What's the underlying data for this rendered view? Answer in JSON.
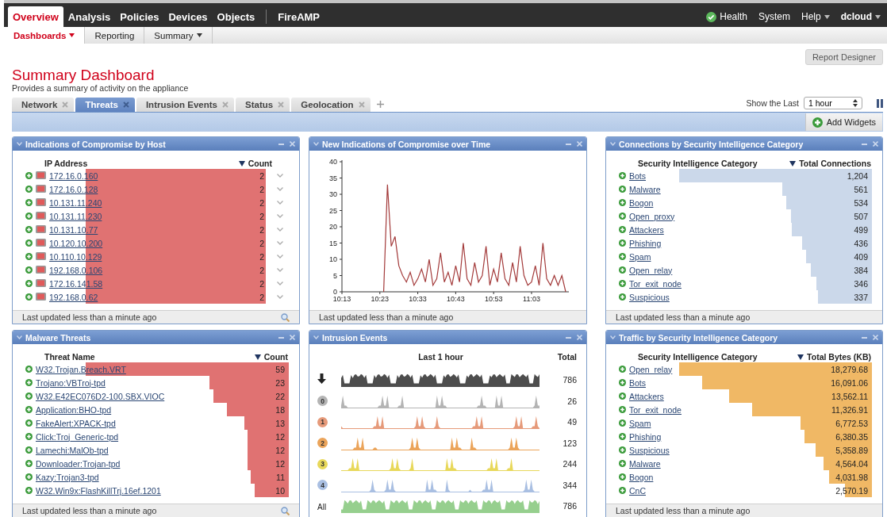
{
  "nav": {
    "items": [
      {
        "label": "Overview",
        "selected": true,
        "divider_before": false
      },
      {
        "label": "Analysis",
        "selected": false,
        "divider_before": false
      },
      {
        "label": "Policies",
        "selected": false,
        "divider_before": false
      },
      {
        "label": "Devices",
        "selected": false,
        "divider_before": false
      },
      {
        "label": "Objects",
        "selected": false,
        "divider_before": false
      },
      {
        "label": "FireAMP",
        "selected": false,
        "divider_before": true
      }
    ],
    "right": [
      {
        "label": "Health",
        "kind": "health"
      },
      {
        "label": "System",
        "kind": "link"
      },
      {
        "label": "Help",
        "kind": "menu"
      },
      {
        "label": "dcloud",
        "kind": "user"
      }
    ]
  },
  "subnav": [
    {
      "label": "Dashboards",
      "selected": true,
      "menu": true
    },
    {
      "label": "Reporting",
      "selected": false,
      "menu": false
    },
    {
      "label": "Summary",
      "selected": false,
      "menu": true
    }
  ],
  "report_button": "Report Designer",
  "title": "Summary Dashboard",
  "subtitle": "Provides a summary of activity on the appliance",
  "tabs": [
    {
      "label": "Network",
      "selected": false
    },
    {
      "label": "Threats",
      "selected": true
    },
    {
      "label": "Intrusion Events",
      "selected": false
    },
    {
      "label": "Status",
      "selected": false
    },
    {
      "label": "Geolocation",
      "selected": false
    }
  ],
  "show_last": {
    "label": "Show the Last",
    "value": "1 hour"
  },
  "add_widgets": "Add Widgets",
  "widgets": [
    {
      "kind": "bar_table",
      "title": "Indications of Compromise by Host",
      "color": "#e07272",
      "host_icons": true,
      "row_menu": true,
      "columns": [
        "IP Address",
        "Count"
      ],
      "rows": [
        {
          "label": "172.16.0.160",
          "value": "2"
        },
        {
          "label": "172.16.0.128",
          "value": "2"
        },
        {
          "label": "10.131.11.240",
          "value": "2"
        },
        {
          "label": "10.131.11.230",
          "value": "2"
        },
        {
          "label": "10.131.10.77",
          "value": "2"
        },
        {
          "label": "10.120.10.200",
          "value": "2"
        },
        {
          "label": "10.110.10.129",
          "value": "2"
        },
        {
          "label": "192.168.0.106",
          "value": "2"
        },
        {
          "label": "172.16.141.58",
          "value": "2"
        },
        {
          "label": "192.168.0.62",
          "value": "2"
        }
      ],
      "footer": {
        "text": "Last updated less than a minute ago",
        "search": true
      }
    },
    {
      "kind": "line_chart",
      "title": "New Indications of Compromise over Time",
      "chart_data": {
        "type": "line",
        "categories": [
          "10:13",
          null,
          null,
          null,
          null,
          null,
          null,
          null,
          null,
          null,
          "10:23",
          null,
          null,
          null,
          null,
          null,
          null,
          null,
          null,
          null,
          "10:33",
          null,
          null,
          null,
          null,
          null,
          null,
          null,
          null,
          null,
          "10:43",
          null,
          null,
          null,
          null,
          null,
          null,
          null,
          null,
          null,
          "10:53",
          null,
          null,
          null,
          null,
          null,
          null,
          null,
          null,
          null,
          "11:03",
          null,
          null,
          null,
          null,
          null,
          null,
          null,
          null,
          null
        ],
        "series": [
          {
            "color": "#a33a3a",
            "values": [
              null,
              null,
              null,
              null,
              null,
              null,
              null,
              null,
              null,
              null,
              null,
              0,
              33,
              14,
              17,
              8,
              5,
              3,
              6,
              2,
              4,
              7,
              3,
              10,
              2,
              4,
              12,
              3,
              6,
              2,
              8,
              3,
              15,
              4,
              2,
              9,
              3,
              5,
              14,
              2,
              7,
              3,
              12,
              4,
              2,
              9,
              3,
              14,
              5,
              2,
              3,
              8,
              2,
              15,
              4,
              2,
              5,
              2,
              5,
              0
            ]
          }
        ],
        "ylim": [
          0,
          40
        ],
        "yticks": [
          0,
          5,
          10,
          15,
          20,
          25,
          30,
          35,
          40
        ]
      },
      "footer": {
        "text": "Last updated less than a minute ago",
        "search": false
      }
    },
    {
      "kind": "bar_table",
      "title": "Connections by Security Intelligence Category",
      "color": "#cbd8ea",
      "host_icons": false,
      "row_menu": false,
      "columns": [
        "Security Intelligence Category",
        "Total Connections"
      ],
      "rows": [
        {
          "label": "Bots",
          "value": "1,204"
        },
        {
          "label": "Malware",
          "value": "561"
        },
        {
          "label": "Bogon",
          "value": "534"
        },
        {
          "label": "Open_proxy",
          "value": "507"
        },
        {
          "label": "Attackers",
          "value": "499"
        },
        {
          "label": "Phishing",
          "value": "436"
        },
        {
          "label": "Spam",
          "value": "409"
        },
        {
          "label": "Open_relay",
          "value": "384"
        },
        {
          "label": "Tor_exit_node",
          "value": "346"
        },
        {
          "label": "Suspicious",
          "value": "337"
        }
      ],
      "footer": {
        "text": "Last updated less than a minute ago",
        "search": false
      }
    },
    {
      "kind": "bar_table",
      "title": "Malware Threats",
      "color": "#e07272",
      "host_icons": false,
      "row_menu": false,
      "columns": [
        "Threat Name",
        "Count"
      ],
      "rows": [
        {
          "label": "W32.Trojan.Breach.VRT",
          "value": "59"
        },
        {
          "label": "Trojano:VBTroj-tpd",
          "value": "23"
        },
        {
          "label": "W32.E42EC076D2-100.SBX.VIOC",
          "value": "22"
        },
        {
          "label": "Application:BHO-tpd",
          "value": "18"
        },
        {
          "label": "FakeAlert:XPACK-tpd",
          "value": "13"
        },
        {
          "label": "Click:Troj_Generic-tpd",
          "value": "12"
        },
        {
          "label": "Lamechi:MalOb-tpd",
          "value": "12"
        },
        {
          "label": "Downloader:Trojan-tpd",
          "value": "12"
        },
        {
          "label": "Kazy:Trojan3-tpd",
          "value": "11"
        },
        {
          "label": "W32.Win9x:FlashKillTrj.16ef.1201",
          "value": "10"
        }
      ],
      "footer": {
        "text": "Last updated less than a minute ago",
        "search": true
      }
    },
    {
      "kind": "sparklines",
      "title": "Intrusion Events",
      "columns": [
        "Last 1 hour",
        "Total"
      ],
      "rows": [
        {
          "kind": "arrow",
          "total": "786",
          "color": "#4d4d4d"
        },
        {
          "kind": "priority",
          "label": "0",
          "total": "26",
          "color": "#b4b4b4"
        },
        {
          "kind": "priority",
          "label": "1",
          "total": "49",
          "color": "#e69a7a"
        },
        {
          "kind": "priority",
          "label": "2",
          "total": "123",
          "color": "#eba45a"
        },
        {
          "kind": "priority",
          "label": "3",
          "total": "244",
          "color": "#e8d85a"
        },
        {
          "kind": "priority",
          "label": "4",
          "total": "344",
          "color": "#a9bfe2"
        },
        {
          "kind": "all",
          "label": "All",
          "total": "786",
          "color": "#96cf8e"
        }
      ]
    },
    {
      "kind": "bar_table",
      "title": "Traffic by Security Intelligence Category",
      "color": "#f0b865",
      "host_icons": false,
      "row_menu": false,
      "columns": [
        "Security Intelligence Category",
        "Total Bytes (KB)"
      ],
      "rows": [
        {
          "label": "Open_relay",
          "value": "18,279.68"
        },
        {
          "label": "Bots",
          "value": "16,091.06"
        },
        {
          "label": "Attackers",
          "value": "13,562.11"
        },
        {
          "label": "Tor_exit_node",
          "value": "11,326.91"
        },
        {
          "label": "Spam",
          "value": "6,772.53"
        },
        {
          "label": "Phishing",
          "value": "6,380.35"
        },
        {
          "label": "Suspicious",
          "value": "5,358.89"
        },
        {
          "label": "Malware",
          "value": "4,564.04"
        },
        {
          "label": "Bogon",
          "value": "4,031.98"
        },
        {
          "label": "CnC",
          "value": "2,570.19"
        }
      ],
      "footer": {
        "text": "Last updated less than a minute ago",
        "search": false
      }
    }
  ]
}
